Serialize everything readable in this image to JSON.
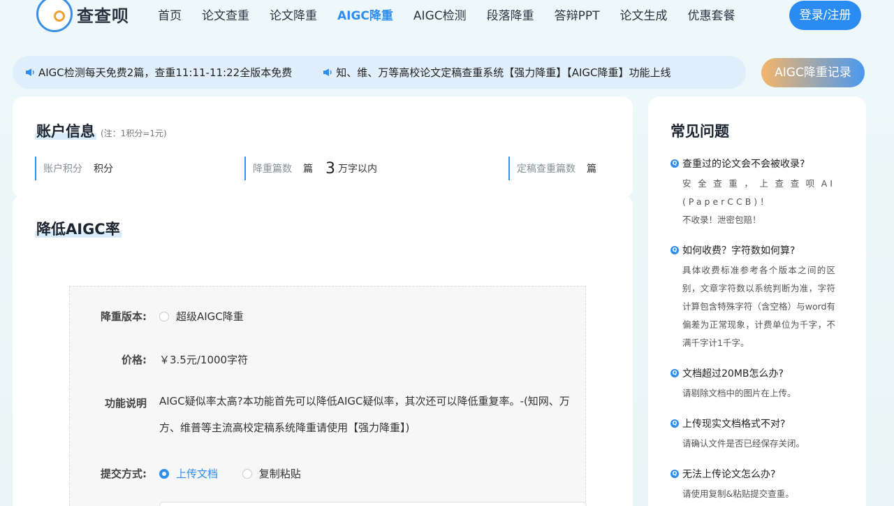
{
  "brand": {
    "name": "查查呗"
  },
  "nav": {
    "items": [
      {
        "label": "首页"
      },
      {
        "label": "论文查重"
      },
      {
        "label": "论文降重"
      },
      {
        "label": "AIGC降重",
        "active": true
      },
      {
        "label": "AIGC检测"
      },
      {
        "label": "段落降重"
      },
      {
        "label": "答辩PPT"
      },
      {
        "label": "论文生成"
      },
      {
        "label": "优惠套餐"
      }
    ],
    "login_label": "登录/注册"
  },
  "notices": [
    "AIGC检测每天免费2篇，查重11:11-11:22全版本免费",
    "知、维、万等高校论文定稿查重系统【强力降重】【AIGC降重】功能上线"
  ],
  "record_button": "AIGC降重记录",
  "account": {
    "title": "账户信息",
    "note": "(注：1积分=1元)",
    "points_label": "账户积分",
    "points_unit": "积分",
    "reduce_label": "降重篇数",
    "reduce_unit": "篇",
    "reduce_count": "3",
    "reduce_suffix": "万字以内",
    "final_label": "定稿查重篇数",
    "final_unit": "篇"
  },
  "main": {
    "title": "降低AIGC率",
    "version_label": "降重版本:",
    "version_option": "超级AIGC降重",
    "price_label": "价格:",
    "price_value": "￥3.5元/1000字符",
    "func_label": "功能说明",
    "func_desc": "AIGC疑似率太高?本功能首先可以降低AIGC疑似率，其次还可以降低重复率。-(知网、万方、维普等主流高校定稿系统降重请使用【强力降重】)",
    "submit_label": "提交方式:",
    "submit_options": [
      "上传文档",
      "复制粘贴"
    ]
  },
  "faq": {
    "title": "常见问题",
    "items": [
      {
        "q": "查重过的论文会不会被收录?",
        "a": "安全查重，上查查呗AI (PaperCCB)！",
        "a2": "不收录！泄密包赔！"
      },
      {
        "q": "如何收费？字符数如何算?",
        "a": "具体收费标准参考各个版本之间的区别，文章字符数以系统判断为准，字符计算包含特殊字符（含空格）与word有偏差为正常现象，计费单位为千字，不满千字计1千字。"
      },
      {
        "q": "文档超过20MB怎么办?",
        "a": "请剔除文档中的图片在上传。"
      },
      {
        "q": "上传现实文档格式不对?",
        "a": "请确认文件是否已经保存关闭。"
      },
      {
        "q": "无法上传论文怎么办?",
        "a": "请使用复制&粘贴提交查重。"
      }
    ]
  }
}
